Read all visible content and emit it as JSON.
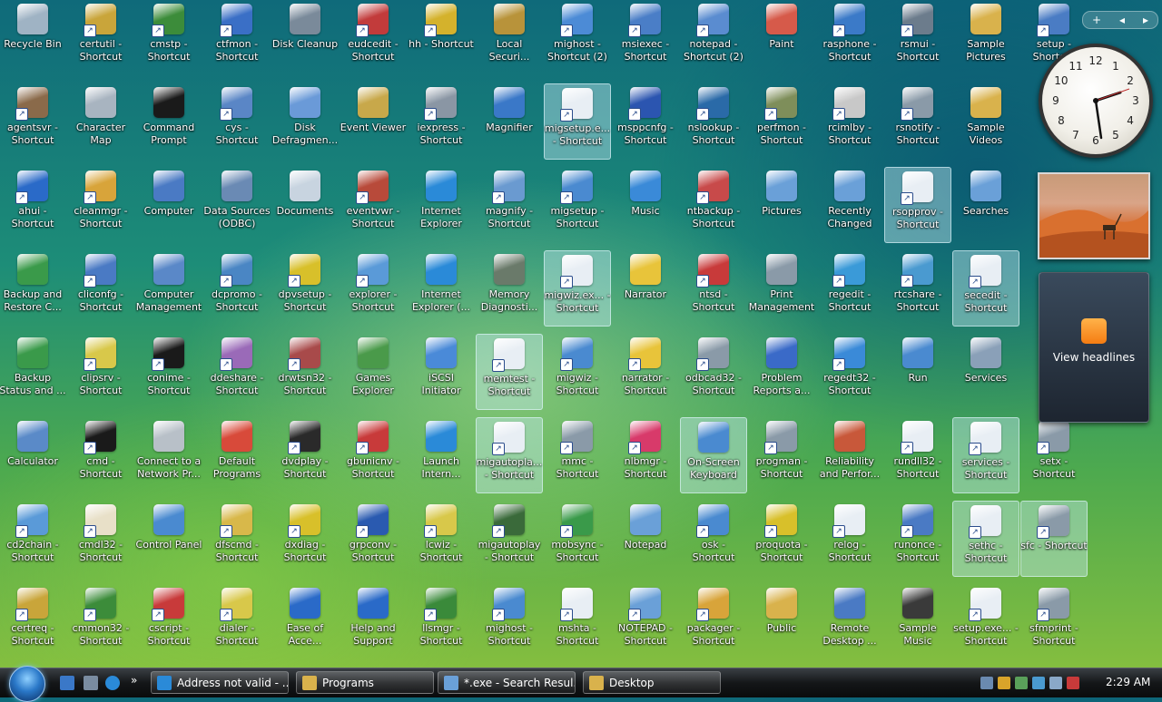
{
  "desktop_icons": [
    {
      "label": "Recycle Bin",
      "icon": "recycle-bin-icon",
      "color": "#9fb3c4"
    },
    {
      "label": "certutil - Shortcut",
      "icon": "certutil-icon",
      "color": "#c9a53a"
    },
    {
      "label": "cmstp - Shortcut",
      "icon": "cmstp-icon",
      "color": "#3c8c3a"
    },
    {
      "label": "ctfmon - Shortcut",
      "icon": "ctfmon-icon",
      "color": "#3a6fc6"
    },
    {
      "label": "Disk Cleanup",
      "icon": "disk-cleanup-icon",
      "color": "#7a8a9a"
    },
    {
      "label": "eudcedit - Shortcut",
      "icon": "eudcedit-icon",
      "color": "#c23b3b"
    },
    {
      "label": "hh - Shortcut",
      "icon": "help-icon",
      "color": "#d4b22c"
    },
    {
      "label": "Local Securi...",
      "icon": "security-lock-icon",
      "color": "#b8933a"
    },
    {
      "label": "mighost - Shortcut (2)",
      "icon": "migration-icon",
      "color": "#4c8bd6"
    },
    {
      "label": "msiexec - Shortcut",
      "icon": "installer-icon",
      "color": "#4a7ec7"
    },
    {
      "label": "notepad - Shortcut (2)",
      "icon": "notepad-icon",
      "color": "#5a8cd0"
    },
    {
      "label": "Paint",
      "icon": "paint-icon",
      "color": "#d65a4a"
    },
    {
      "label": "rasphone - Shortcut",
      "icon": "network-icon",
      "color": "#3b7ac8"
    },
    {
      "label": "rsmui - Shortcut",
      "icon": "storage-icon",
      "color": "#6c7c8c"
    },
    {
      "label": "Sample Pictures",
      "icon": "folder-icon",
      "color": "#d9b24c"
    },
    {
      "label": "setup - Shortcut",
      "icon": "setup-icon",
      "color": "#4a7cc4"
    },
    {
      "label": "agentsvr - Shortcut",
      "icon": "agent-icon",
      "color": "#8a6a4a"
    },
    {
      "label": "Character Map",
      "icon": "charmap-icon",
      "color": "#a8b4c0"
    },
    {
      "label": "Command Prompt",
      "icon": "command-prompt-icon",
      "color": "#1a1a1a"
    },
    {
      "label": "cys - Shortcut",
      "icon": "cys-icon",
      "color": "#5a86c6"
    },
    {
      "label": "Disk Defragmen...",
      "icon": "defrag-icon",
      "color": "#6a9ad8"
    },
    {
      "label": "Event Viewer",
      "icon": "event-viewer-icon",
      "color": "#c8a84a"
    },
    {
      "label": "iexpress - Shortcut",
      "icon": "iexpress-icon",
      "color": "#8a96a4"
    },
    {
      "label": "Magnifier",
      "icon": "magnifier-icon",
      "color": "#3a78c8"
    },
    {
      "label": "migsetup.e... - Shortcut",
      "icon": "file-icon",
      "color": "#e8eef4",
      "selected": true
    },
    {
      "label": "msppcnfg - Shortcut",
      "icon": "msppcnfg-icon",
      "color": "#2b55b0"
    },
    {
      "label": "nslookup - Shortcut",
      "icon": "nslookup-icon",
      "color": "#2a6aa8"
    },
    {
      "label": "perfmon - Shortcut",
      "icon": "perfmon-icon",
      "color": "#7e8e5a"
    },
    {
      "label": "rcimlby - Shortcut",
      "icon": "rcimlby-icon",
      "color": "#c8c8c8"
    },
    {
      "label": "rsnotify - Shortcut",
      "icon": "rsnotify-icon",
      "color": "#8a9aa8"
    },
    {
      "label": "Sample Videos",
      "icon": "folder-icon",
      "color": "#d9b24c"
    },
    {
      "label": "ahui - Shortcut",
      "icon": "info-icon",
      "color": "#2a6ac8"
    },
    {
      "label": "cleanmgr - Shortcut",
      "icon": "cleanmgr-icon",
      "color": "#d8a43a"
    },
    {
      "label": "Computer",
      "icon": "computer-icon",
      "color": "#4a7ac4"
    },
    {
      "label": "Data Sources (ODBC)",
      "icon": "odbc-icon",
      "color": "#6a8ab4"
    },
    {
      "label": "Documents",
      "icon": "documents-icon",
      "color": "#c8d4e0"
    },
    {
      "label": "eventvwr - Shortcut",
      "icon": "eventvwr-icon",
      "color": "#b84a3a"
    },
    {
      "label": "Internet Explorer",
      "icon": "internet-explorer-icon",
      "color": "#2a8ad8"
    },
    {
      "label": "magnify - Shortcut",
      "icon": "magnify-icon",
      "color": "#6a9ad0"
    },
    {
      "label": "migsetup - Shortcut",
      "icon": "migsetup-icon",
      "color": "#4a8ad0"
    },
    {
      "label": "Music",
      "icon": "music-icon",
      "color": "#3a8ad8"
    },
    {
      "label": "ntbackup - Shortcut",
      "icon": "ntbackup-icon",
      "color": "#c84a4a"
    },
    {
      "label": "Pictures",
      "icon": "pictures-icon",
      "color": "#6aa0d8"
    },
    {
      "label": "Recently Changed",
      "icon": "recent-icon",
      "color": "#6aa0d8"
    },
    {
      "label": "rsopprov - Shortcut",
      "icon": "file-icon",
      "color": "#e8eef4",
      "selected": true
    },
    {
      "label": "Searches",
      "icon": "search-icon",
      "color": "#6aa0d8"
    },
    {
      "label": "Backup and Restore C...",
      "icon": "backup-icon",
      "color": "#3a9a4a"
    },
    {
      "label": "cliconfg - Shortcut",
      "icon": "cliconfg-icon",
      "color": "#4a7ac4"
    },
    {
      "label": "Computer Management",
      "icon": "computer-management-icon",
      "color": "#5a88c8"
    },
    {
      "label": "dcpromo - Shortcut",
      "icon": "dcpromo-icon",
      "color": "#4a86c4"
    },
    {
      "label": "dpvsetup - Shortcut",
      "icon": "dpvsetup-icon",
      "color": "#d8c02a"
    },
    {
      "label": "explorer - Shortcut",
      "icon": "explorer-icon",
      "color": "#5a9ad8"
    },
    {
      "label": "Internet Explorer (...",
      "icon": "internet-explorer-icon",
      "color": "#2a8ad8"
    },
    {
      "label": "Memory Diagnosti...",
      "icon": "memory-icon",
      "color": "#6a7a6a"
    },
    {
      "label": "migwiz.ex... - Shortcut",
      "icon": "file-icon",
      "color": "#e8eef4",
      "selected": true
    },
    {
      "label": "Narrator",
      "icon": "narrator-icon",
      "color": "#e8c43a"
    },
    {
      "label": "ntsd - Shortcut",
      "icon": "ntsd-icon",
      "color": "#c83a3a"
    },
    {
      "label": "Print Management",
      "icon": "print-icon",
      "color": "#8a9aa8"
    },
    {
      "label": "regedit - Shortcut",
      "icon": "regedit-icon",
      "color": "#3a9ad8"
    },
    {
      "label": "rtcshare - Shortcut",
      "icon": "rtcshare-icon",
      "color": "#4a9ad0"
    },
    {
      "label": "secedit - Shortcut",
      "icon": "file-icon",
      "color": "#e8eef4",
      "selected": true
    },
    {
      "label": "Backup Status and ...",
      "icon": "backup-status-icon",
      "color": "#3a9a4a"
    },
    {
      "label": "clipsrv - Shortcut",
      "icon": "clipsrv-icon",
      "color": "#d8c84a"
    },
    {
      "label": "conime - Shortcut",
      "icon": "conime-icon",
      "color": "#1a1a1a"
    },
    {
      "label": "ddeshare - Shortcut",
      "icon": "ddeshare-icon",
      "color": "#9a6ab8"
    },
    {
      "label": "drwtsn32 - Shortcut",
      "icon": "drwtsn32-icon",
      "color": "#a84a4a"
    },
    {
      "label": "Games Explorer",
      "icon": "games-icon",
      "color": "#4a9a4a"
    },
    {
      "label": "iSCSI Initiator",
      "icon": "iscsi-icon",
      "color": "#4a8ad8"
    },
    {
      "label": "memtest - Shortcut",
      "icon": "file-icon",
      "color": "#e8eef4",
      "selected": true
    },
    {
      "label": "migwiz - Shortcut",
      "icon": "migwiz-icon",
      "color": "#4a8ad0"
    },
    {
      "label": "narrator - Shortcut",
      "icon": "narrator-icon",
      "color": "#e8c43a"
    },
    {
      "label": "odbcad32 - Shortcut",
      "icon": "odbcad32-icon",
      "color": "#8a9aa8"
    },
    {
      "label": "Problem Reports a...",
      "icon": "problem-reports-icon",
      "color": "#3a6ac8"
    },
    {
      "label": "regedt32 - Shortcut",
      "icon": "regedt32-icon",
      "color": "#3a8ad8"
    },
    {
      "label": "Run",
      "icon": "run-icon",
      "color": "#4a8ad0"
    },
    {
      "label": "Services",
      "icon": "services-icon",
      "color": "#8aa0b8"
    },
    {
      "label": "Calculator",
      "icon": "calculator-icon",
      "color": "#5a8ac8"
    },
    {
      "label": "cmd - Shortcut",
      "icon": "cmd-icon",
      "color": "#1a1a1a"
    },
    {
      "label": "Connect to a Network Pr...",
      "icon": "network-projector-icon",
      "color": "#b8c0c8"
    },
    {
      "label": "Default Programs",
      "icon": "default-programs-icon",
      "color": "#d84a3a"
    },
    {
      "label": "dvdplay - Shortcut",
      "icon": "dvd-icon",
      "color": "#2a2a2a"
    },
    {
      "label": "gbunicnv - Shortcut",
      "icon": "gbunicnv-icon",
      "color": "#c83a3a"
    },
    {
      "label": "Launch Intern...",
      "icon": "internet-explorer-icon",
      "color": "#2a8ad8"
    },
    {
      "label": "migautopla... - Shortcut",
      "icon": "file-icon",
      "color": "#e8eef4",
      "selected": true
    },
    {
      "label": "mmc - Shortcut",
      "icon": "mmc-icon",
      "color": "#8a9aa8"
    },
    {
      "label": "nlbmgr - Shortcut",
      "icon": "nlbmgr-icon",
      "color": "#d83a6a"
    },
    {
      "label": "On-Screen Keyboard",
      "icon": "keyboard-icon",
      "color": "#4a8ad0",
      "selected": true
    },
    {
      "label": "progman - Shortcut",
      "icon": "progman-icon",
      "color": "#8a9aa8"
    },
    {
      "label": "Reliability and Perfor...",
      "icon": "reliability-icon",
      "color": "#c8583a"
    },
    {
      "label": "rundll32 - Shortcut",
      "icon": "rundll32-icon",
      "color": "#e8eef4"
    },
    {
      "label": "services - Shortcut",
      "icon": "file-icon",
      "color": "#e8eef4",
      "selected": true
    },
    {
      "label": "setx - Shortcut",
      "icon": "setx-icon",
      "color": "#8a9aa8"
    },
    {
      "label": "cd2chain - Shortcut",
      "icon": "cd2chain-icon",
      "color": "#5a9ad8"
    },
    {
      "label": "cmdl32 - Shortcut",
      "icon": "cmdl32-icon",
      "color": "#e8e0c8"
    },
    {
      "label": "Control Panel",
      "icon": "control-panel-icon",
      "color": "#4a8ad0"
    },
    {
      "label": "dfscmd - Shortcut",
      "icon": "dfscmd-icon",
      "color": "#d8b84a"
    },
    {
      "label": "dxdiag - Shortcut",
      "icon": "dxdiag-icon",
      "color": "#d8c02a"
    },
    {
      "label": "grpconv - Shortcut",
      "icon": "grpconv-icon",
      "color": "#2a5ab0"
    },
    {
      "label": "lcwiz - Shortcut",
      "icon": "lcwiz-icon",
      "color": "#d8c84a"
    },
    {
      "label": "migautoplay - Shortcut",
      "icon": "migautoplay-icon",
      "color": "#3a6a3a"
    },
    {
      "label": "mobsync - Shortcut",
      "icon": "mobsync-icon",
      "color": "#3a9a4a"
    },
    {
      "label": "Notepad",
      "icon": "notepad-icon",
      "color": "#6aa0d8"
    },
    {
      "label": "osk - Shortcut",
      "icon": "osk-icon",
      "color": "#4a8ad0"
    },
    {
      "label": "proquota - Shortcut",
      "icon": "proquota-icon",
      "color": "#d8c02a"
    },
    {
      "label": "relog - Shortcut",
      "icon": "relog-icon",
      "color": "#e8eef4"
    },
    {
      "label": "runonce - Shortcut",
      "icon": "runonce-icon",
      "color": "#4a7ac4"
    },
    {
      "label": "sethc - Shortcut",
      "icon": "file-icon",
      "color": "#e8eef4",
      "selected": true
    },
    {
      "label": "sfc - Shortcut",
      "icon": "sfc-icon",
      "color": "#8a9aa8",
      "selected": true
    },
    {
      "label": "certreq - Shortcut",
      "icon": "certreq-icon",
      "color": "#c9a53a"
    },
    {
      "label": "cmmon32 - Shortcut",
      "icon": "cmmon32-icon",
      "color": "#3c8c3a"
    },
    {
      "label": "cscript - Shortcut",
      "icon": "cscript-icon",
      "color": "#c83a3a"
    },
    {
      "label": "dialer - Shortcut",
      "icon": "dialer-icon",
      "color": "#d8c84a"
    },
    {
      "label": "Ease of Acce...",
      "icon": "ease-of-access-icon",
      "color": "#2a6ac8"
    },
    {
      "label": "Help and Support",
      "icon": "help-support-icon",
      "color": "#2a6ac8"
    },
    {
      "label": "llsmgr - Shortcut",
      "icon": "llsmgr-icon",
      "color": "#3a8a3a"
    },
    {
      "label": "mighost - Shortcut",
      "icon": "mighost-icon",
      "color": "#4a8ad0"
    },
    {
      "label": "mshta - Shortcut",
      "icon": "mshta-icon",
      "color": "#e8eef4"
    },
    {
      "label": "NOTEPAD - Shortcut",
      "icon": "notepad-icon",
      "color": "#6aa0d8"
    },
    {
      "label": "packager - Shortcut",
      "icon": "packager-icon",
      "color": "#d8a43a"
    },
    {
      "label": "Public",
      "icon": "folder-icon",
      "color": "#d9b24c"
    },
    {
      "label": "Remote Desktop ...",
      "icon": "remote-desktop-icon",
      "color": "#4a7ac4"
    },
    {
      "label": "Sample Music",
      "icon": "folder-icon",
      "color": "#3a3a3a"
    },
    {
      "label": "setup.exe... - Shortcut",
      "icon": "file-icon",
      "color": "#e8eef4"
    },
    {
      "label": "sfmprint - Shortcut",
      "icon": "sfmprint-icon",
      "color": "#8a9aa8"
    }
  ],
  "sidebar": {
    "add_gadget": "+",
    "prev": "◂",
    "next": "▸",
    "clock_numbers": [
      "12",
      "1",
      "2",
      "3",
      "4",
      "5",
      "6",
      "7",
      "8",
      "9",
      "10",
      "11"
    ],
    "feed_label": "View headlines"
  },
  "taskbar": {
    "start_label": "Start",
    "quick_launch": [
      "show-desktop-icon",
      "switch-windows-icon",
      "internet-explorer-icon"
    ],
    "chevron": "»",
    "tasks": [
      {
        "label": "Address not valid - ...",
        "icon": "internet-explorer-icon",
        "color": "#2a8ad8"
      },
      {
        "label": "Programs",
        "icon": "folder-icon",
        "color": "#d9b24c"
      },
      {
        "label": "*.exe - Search Resul...",
        "icon": "search-icon",
        "color": "#6aa0d8"
      },
      {
        "label": "Desktop",
        "icon": "folder-icon",
        "color": "#d9b24c"
      }
    ],
    "tray_icons": [
      "network-tray-icon",
      "security-shield-icon",
      "windows-defender-icon",
      "sync-icon",
      "network-connection-icon",
      "volume-muted-icon"
    ],
    "time": "2:29 AM"
  }
}
